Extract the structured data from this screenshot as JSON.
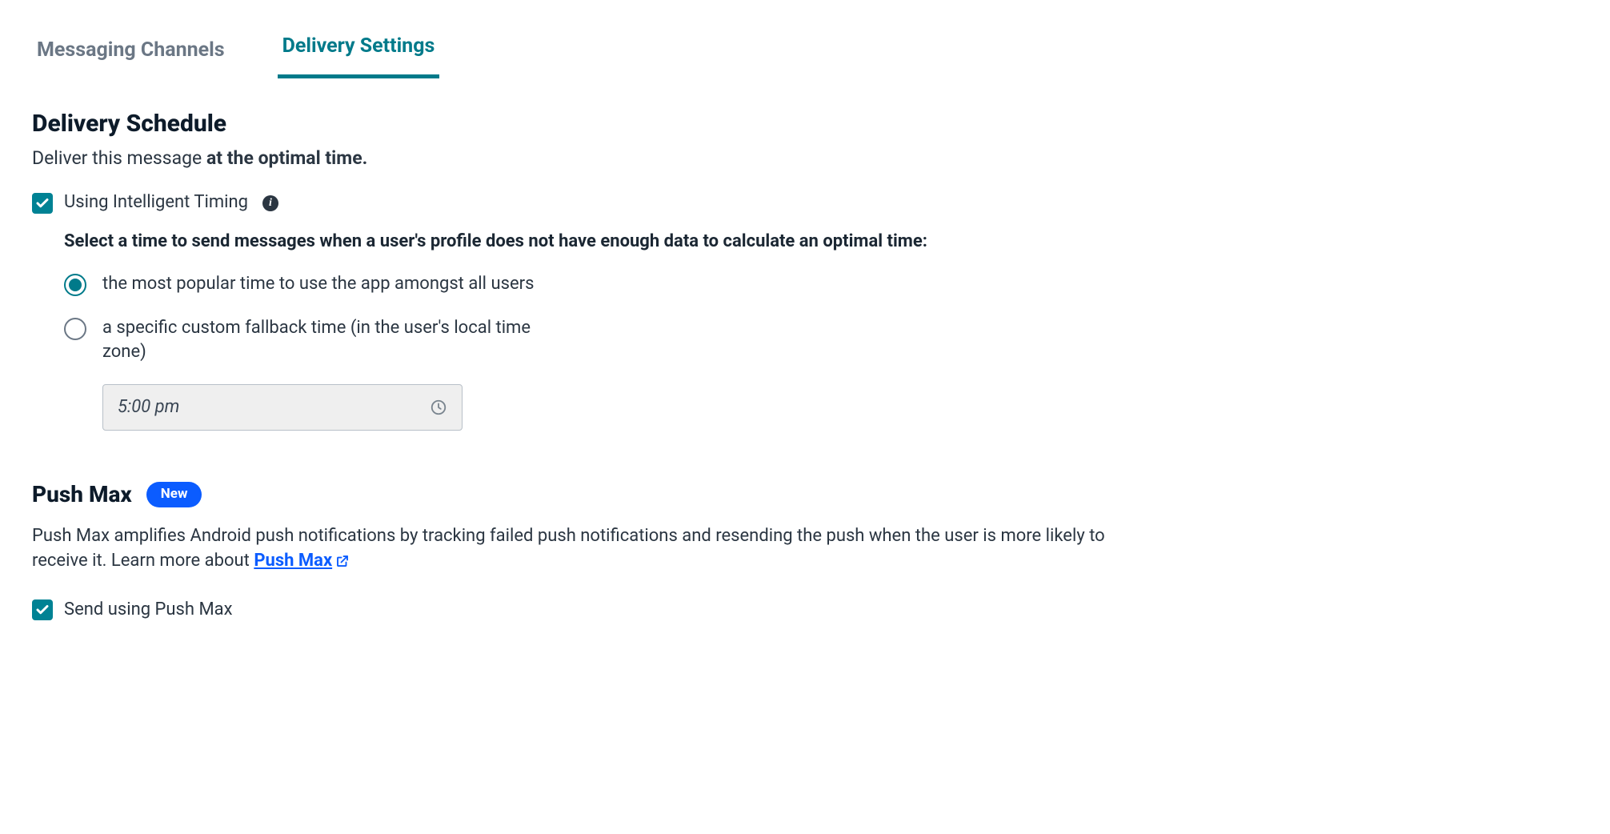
{
  "tabs": {
    "messaging_channels": "Messaging Channels",
    "delivery_settings": "Delivery Settings"
  },
  "deliverySchedule": {
    "heading": "Delivery Schedule",
    "subhead_prefix": "Deliver this message ",
    "subhead_bold": "at the optimal time.",
    "intelligentTimingLabel": "Using Intelligent Timing",
    "instruction": "Select a time to send messages when a user's profile does not have enough data to calculate an optimal time:",
    "option1": "the most popular time to use the app amongst all users",
    "option2": "a specific custom fallback time (in the user's local time zone)",
    "timeInputValue": "5:00 pm"
  },
  "pushMax": {
    "heading": "Push Max",
    "badge": "New",
    "desc_prefix": "Push Max amplifies Android push notifications by tracking failed push notifications and resending the push when the user is more likely to receive it. Learn more about ",
    "link_text": "Push Max",
    "checkboxLabel": "Send using Push Max"
  }
}
